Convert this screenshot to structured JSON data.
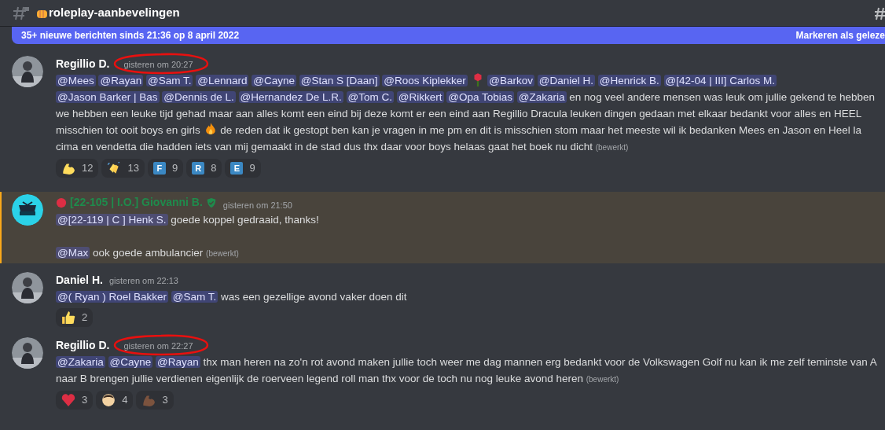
{
  "header": {
    "channel": "roleplay-aanbevelingen"
  },
  "banner": {
    "text": "35+ nieuwe berichten sinds 21:36 op 8 april 2022",
    "action": "Markeren als geleze"
  },
  "messages": [
    {
      "author": "Regillio D.",
      "color": "#ffffff",
      "timestamp": "gisteren om 20:27",
      "circled": true,
      "paragraphs": [
        {
          "segments": [
            {
              "kind": "mention",
              "text": "@Mees"
            },
            {
              "kind": "mention",
              "text": "@Rayan"
            },
            {
              "kind": "mention",
              "text": "@Sam T."
            },
            {
              "kind": "mention",
              "text": "@Lennard"
            },
            {
              "kind": "mention",
              "text": "@Cayne"
            },
            {
              "kind": "mention",
              "text": "@Stan S [Daan]"
            },
            {
              "kind": "mention",
              "text": "@Roos Kiplekker"
            },
            {
              "kind": "rose"
            },
            {
              "kind": "mention",
              "text": "@Barkov"
            },
            {
              "kind": "mention",
              "text": "@Daniel H."
            },
            {
              "kind": "mention",
              "text": "@Henrick B."
            },
            {
              "kind": "mention",
              "text": "@[42-04 | III] Carlos M."
            },
            {
              "kind": "mention",
              "text": "@Jason Barker | Bas"
            },
            {
              "kind": "mention",
              "text": "@Dennis de L."
            },
            {
              "kind": "mention",
              "text": "@Hernandez De L.R."
            },
            {
              "kind": "mention",
              "text": "@Tom C."
            },
            {
              "kind": "mention",
              "text": "@Rikkert"
            },
            {
              "kind": "mention",
              "text": "@Opa Tobias"
            },
            {
              "kind": "mention",
              "text": "@Zakaria"
            },
            {
              "kind": "text",
              "text": " en nog veel andere mensen was leuk om jullie gekend te hebben we hebben een leuke tijd gehad maar aan alles komt een eind bij deze komt er een eind aan Regillio Dracula leuken dingen gedaan met elkaar bedankt voor alles en HEEL misschien tot ooit boys en girls "
            },
            {
              "kind": "fire"
            },
            {
              "kind": "text",
              "text": " de reden dat ik gestopt ben kan je vragen in me pm en dit is misschien stom maar het meeste wil ik bedanken Mees en Jason en Heel la cima en vendetta die hadden iets van mij gemaakt in de stad dus thx daar voor boys helaas gaat het boek nu dicht"
            },
            {
              "kind": "edited",
              "text": "(bewerkt)"
            }
          ]
        }
      ],
      "reactions": [
        {
          "kind": "arm",
          "count": "12"
        },
        {
          "kind": "clap",
          "count": "13"
        },
        {
          "kind": "letter",
          "letter": "F",
          "count": "9"
        },
        {
          "kind": "letter",
          "letter": "R",
          "count": "8"
        },
        {
          "kind": "letter",
          "letter": "E",
          "count": "9"
        }
      ]
    },
    {
      "kind": "logo",
      "author": "[22-105 | I.O.] Giovanni B.",
      "color": "#1f8b4c",
      "timestamp": "gisteren om 21:50",
      "highlighted": true,
      "lead_icon": true,
      "trail_icon": true,
      "paragraphs": [
        {
          "segments": [
            {
              "kind": "mention",
              "text": "@[22-119 | C ] Henk S."
            },
            {
              "kind": "text",
              "text": " goede koppel gedraaid, thanks!"
            }
          ]
        },
        {
          "gap_before": true,
          "segments": [
            {
              "kind": "mention",
              "text": "@Max"
            },
            {
              "kind": "text",
              "text": " ook goede ambulancier"
            },
            {
              "kind": "edited",
              "text": "(bewerkt)"
            }
          ]
        }
      ]
    },
    {
      "author": "Daniel H.",
      "color": "#ffffff",
      "timestamp": "gisteren om 22:13",
      "paragraphs": [
        {
          "segments": [
            {
              "kind": "mention",
              "text": "@( Ryan ) Roel Bakker"
            },
            {
              "kind": "mention",
              "text": "@Sam T."
            },
            {
              "kind": "text",
              "text": " was een gezellige avond vaker doen dit"
            }
          ]
        }
      ],
      "reactions": [
        {
          "kind": "thumb",
          "count": "2"
        }
      ]
    },
    {
      "author": "Regillio D.",
      "color": "#ffffff",
      "timestamp": "gisteren om 22:27",
      "circled": true,
      "paragraphs": [
        {
          "segments": [
            {
              "kind": "mention",
              "text": "@Zakaria"
            },
            {
              "kind": "mention",
              "text": "@Cayne"
            },
            {
              "kind": "mention",
              "text": "@Rayan"
            },
            {
              "kind": "text",
              "text": " thx man heren na zo'n rot avond maken jullie toch weer me dag mannen erg bedankt voor de Volkswagen Golf nu kan ik me zelf teminste van A naar B brengen jullie verdienen eigenlijk de roerveen legend roll man thx voor de toch nu nog leuke avond heren"
            },
            {
              "kind": "edited",
              "text": "(bewerkt)"
            }
          ]
        }
      ],
      "reactions": [
        {
          "kind": "heart",
          "count": "3"
        },
        {
          "kind": "face",
          "count": "4"
        },
        {
          "kind": "arm-dark",
          "count": "3"
        }
      ]
    }
  ]
}
